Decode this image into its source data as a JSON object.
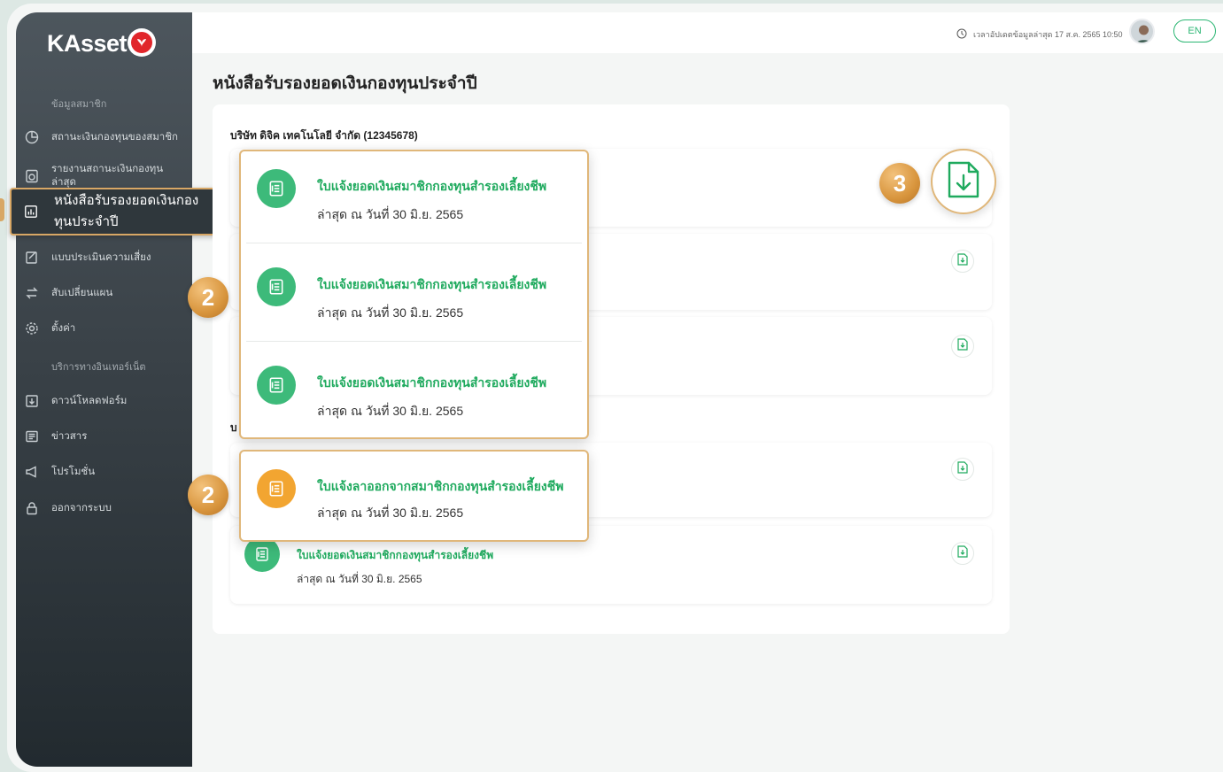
{
  "brand": {
    "name": "KAsset"
  },
  "sidebar": {
    "section_member": "ข้อมูลสมาชิก",
    "items": [
      {
        "label": "สถานะเงินกองทุนของสมาชิก",
        "icon": "pie-chart-icon"
      },
      {
        "label": "รายงานสถานะเงินกองทุน ล่าสุด",
        "icon": "report-icon"
      },
      {
        "label": "หนังสือรับรองยอดเงินกอง ทุนประจำปี",
        "icon": "bar-chart-doc-icon"
      },
      {
        "label": "แบบประเมินความเสี่ยง",
        "icon": "assessment-icon"
      },
      {
        "label": "สับเปลี่ยนแผน",
        "icon": "switch-plan-icon"
      },
      {
        "label": "ตั้งค่า",
        "icon": "gear-icon"
      }
    ],
    "section_services": "บริการทางอินเทอร์เน็ต",
    "service_items": [
      {
        "label": "ดาวน์โหลดฟอร์ม",
        "icon": "download-form-icon"
      },
      {
        "label": "ข่าวสาร",
        "icon": "news-icon"
      },
      {
        "label": "โปรโมชั่น",
        "icon": "megaphone-icon"
      },
      {
        "label": "ออกจากระบบ",
        "icon": "lock-icon"
      }
    ]
  },
  "header": {
    "last_update": "เวลาอัปเดตข้อมูลล่าสุด 17 ส.ค. 2565 10:50",
    "lang_button": "EN"
  },
  "main": {
    "page_title": "หนังสือรับรองยอดเงินกองทุนประจำปี",
    "company_label": "บริษัท ดิจิค เทคโนโลยี จำกัด (12345678)",
    "second_company_label_partial": "บ"
  },
  "popup_statements": {
    "items": [
      {
        "title": "ใบแจ้งยอดเงินสมาชิกกองทุนสำรองเลี้ยงชีพ",
        "subtitle": "ล่าสุด ณ วันที่ 30 มิ.ย. 2565"
      },
      {
        "title": "ใบแจ้งยอดเงินสมาชิกกองทุนสำรองเลี้ยงชีพ",
        "subtitle": "ล่าสุด ณ วันที่ 30 มิ.ย. 2565"
      },
      {
        "title": "ใบแจ้งยอดเงินสมาชิกกองทุนสำรองเลี้ยงชีพ",
        "subtitle": "ล่าสุด ณ วันที่ 30 มิ.ย. 2565"
      }
    ]
  },
  "popup_resign": {
    "title": "ใบแจ้งลาออกจากสมาชิกกองทุนสำรองเลี้ยงชีพ",
    "subtitle": "ล่าสุด ณ วันที่ 30 มิ.ย. 2565"
  },
  "bottom_row": {
    "title": "ใบแจ้งยอดเงินสมาชิกกองทุนสำรองเลี้ยงชีพ",
    "subtitle": "ล่าสุด ณ วันที่ 30 มิ.ย. 2565"
  },
  "badges": {
    "two": "2",
    "three": "3"
  },
  "colors": {
    "accent_green": "#1faa5e",
    "highlight_gold": "#e0b77a",
    "resign_orange": "#f2a531"
  }
}
